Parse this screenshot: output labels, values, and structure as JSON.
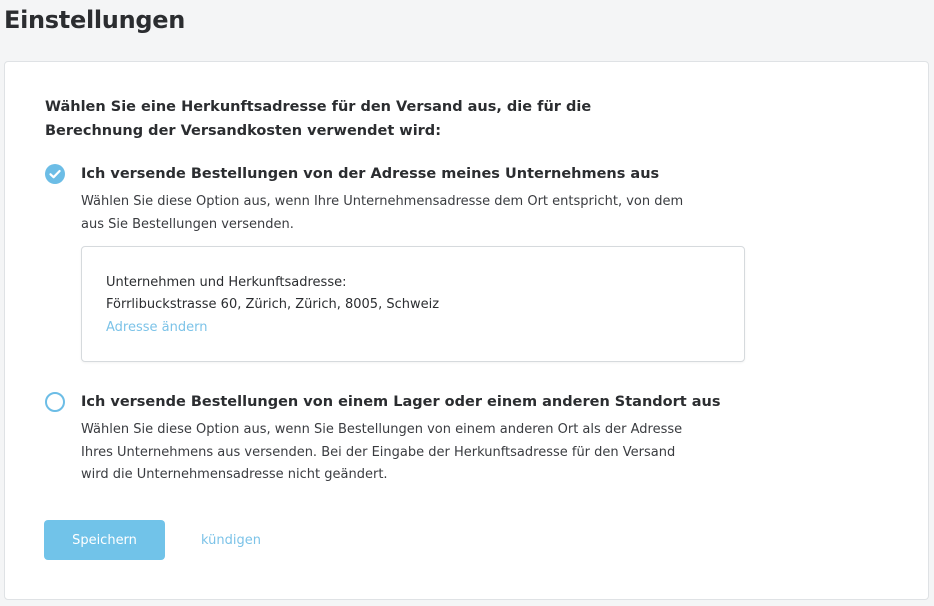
{
  "page": {
    "title": "Einstellungen"
  },
  "intro": {
    "text": "Wählen Sie eine Herkunftsadresse für den Versand aus, die für die Berechnung der Versandkosten verwendet wird:"
  },
  "options": [
    {
      "title": "Ich versende Bestellungen von der Adresse meines Unternehmens aus",
      "description": "Wählen Sie diese Option aus, wenn Ihre Unternehmensadresse dem Ort entspricht, von dem aus Sie Bestellungen versenden.",
      "selected": true
    },
    {
      "title": "Ich versende Bestellungen von einem Lager oder einem anderen Standort aus",
      "description": "Wählen Sie diese Option aus, wenn Sie Bestellungen von einem anderen Ort als der Adresse Ihres Unternehmens aus versenden. Bei der Eingabe der Herkunftsadresse für den Versand wird die Unternehmensadresse nicht geändert.",
      "selected": false
    }
  ],
  "address": {
    "label": "Unternehmen und Herkunftsadresse:",
    "value": "Förrlibuckstrasse 60, Zürich, Zürich, 8005, Schweiz",
    "change_link": "Adresse ändern"
  },
  "actions": {
    "save_label": "Speichern",
    "cancel_label": "kündigen"
  },
  "colors": {
    "accent": "#6cbde6",
    "link": "#7cc3e8",
    "page_bg": "#f4f5f6"
  }
}
